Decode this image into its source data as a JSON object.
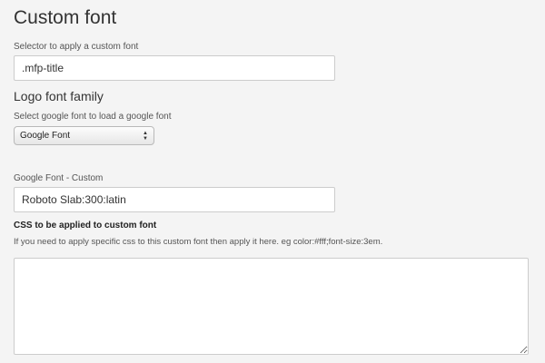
{
  "custom_font": {
    "title": "Custom font",
    "selector_label": "Selector to apply a custom font",
    "selector_value": ".mfp-title"
  },
  "logo_font": {
    "heading": "Logo font family",
    "select_label": "Select google font to load a google font",
    "select_value": "Google Font",
    "select_arrows_icon": "select-up-down-icon"
  },
  "google_font_custom": {
    "label": "Google Font - Custom",
    "value": "Roboto Slab:300:latin"
  },
  "css_section": {
    "label": "CSS to be applied to custom font",
    "help": "If you need to apply specific css to this custom font then apply it here. eg color:#fff;font-size:3em.",
    "value": ""
  }
}
